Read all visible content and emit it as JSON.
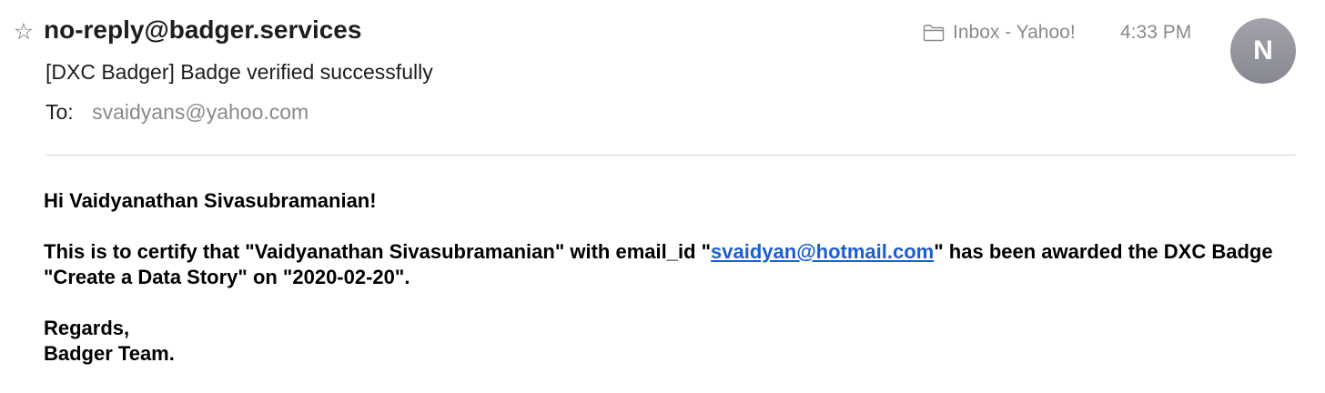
{
  "header": {
    "star_glyph": "☆",
    "sender": "no-reply@badger.services",
    "mailbox": "Inbox - Yahoo!",
    "time": "4:33 PM",
    "avatar_initial": "N",
    "subject": "[DXC Badger] Badge verified successfully",
    "to_label": "To:",
    "to_address": "svaidyans@yahoo.com"
  },
  "body": {
    "greeting": "Hi Vaidyanathan Sivasubramanian!",
    "cert_before_link": "This is to certify that \"Vaidyanathan Sivasubramanian\" with email_id \"",
    "cert_link": "svaidyan@hotmail.com",
    "cert_after_link": "\" has been awarded the DXC Badge \"Create a Data Story\" on \"2020-02-20\".",
    "closing_line1": "Regards,",
    "closing_line2": "Badger Team."
  },
  "icons": {
    "star": "star-icon",
    "folder": "folder-icon"
  },
  "colors": {
    "link": "#1a5fd1",
    "muted_text": "#8a8a8e",
    "avatar_bg": "#929399"
  }
}
